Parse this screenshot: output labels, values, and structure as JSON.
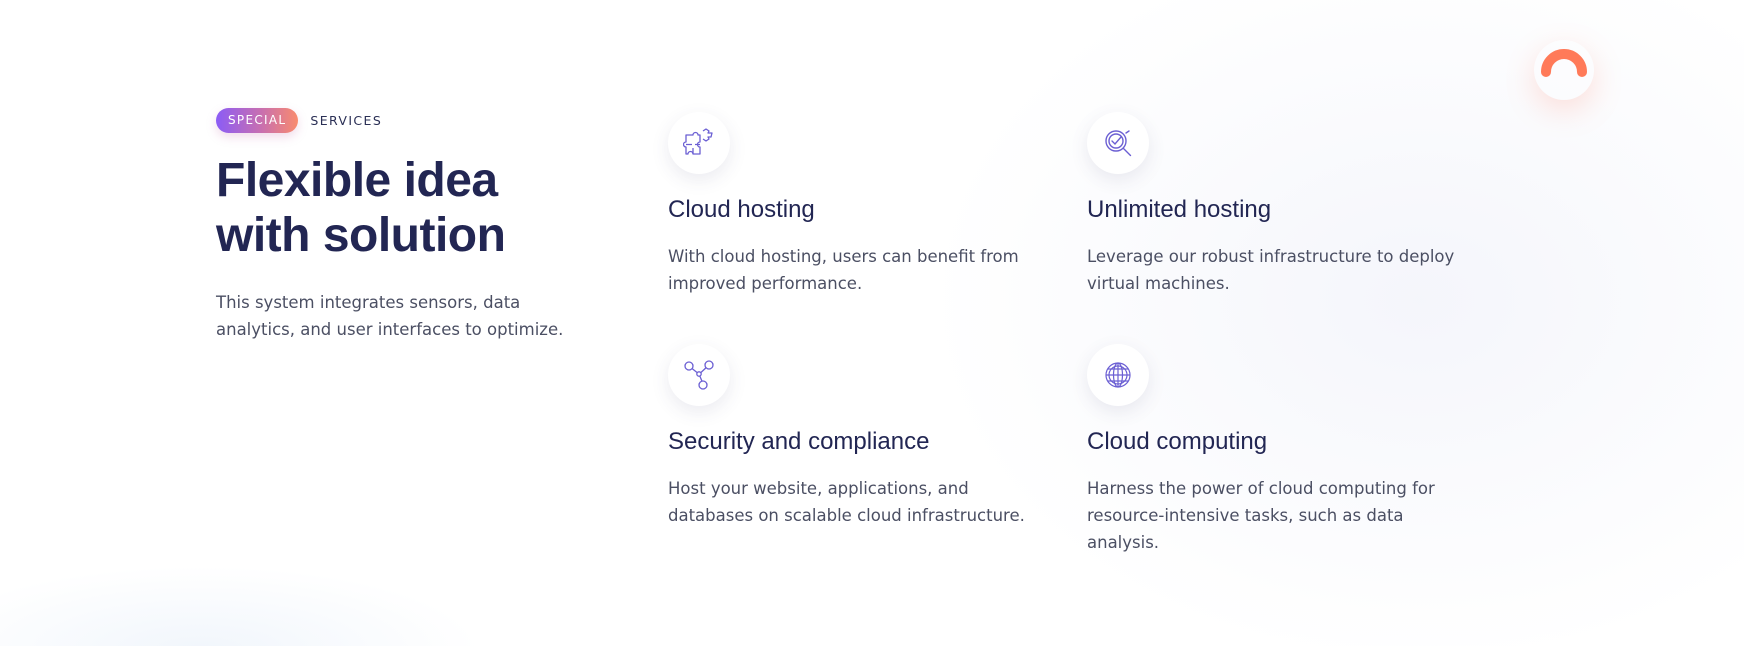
{
  "intro": {
    "badge": "SPECIAL",
    "eyebrow": "SERVICES",
    "headline_line1": "Flexible idea",
    "headline_line2": "with solution",
    "lead": "This system integrates sensors, data analytics, and user interfaces to optimize."
  },
  "services": [
    {
      "icon": "puzzle-icon",
      "title": "Cloud hosting",
      "description": "With cloud hosting, users can benefit from improved performance."
    },
    {
      "icon": "magnifier-check-icon",
      "title": "Unlimited hosting",
      "description": "Leverage our robust infrastructure to deploy virtual machines."
    },
    {
      "icon": "share-nodes-icon",
      "title": "Security and compliance",
      "description": "Host your website, applications, and databases on scalable cloud infrastructure."
    },
    {
      "icon": "globe-icon",
      "title": "Cloud computing",
      "description": "Harness the power of cloud computing for resource-intensive tasks, such as data analysis."
    }
  ],
  "colors": {
    "heading": "#222653",
    "body_text": "#4b4f63",
    "icon_stroke": "#6b5fd3",
    "badge_gradient_start": "#8b5cf6",
    "badge_gradient_end": "#f98b6e",
    "accent_arc": "#ff7a59"
  }
}
